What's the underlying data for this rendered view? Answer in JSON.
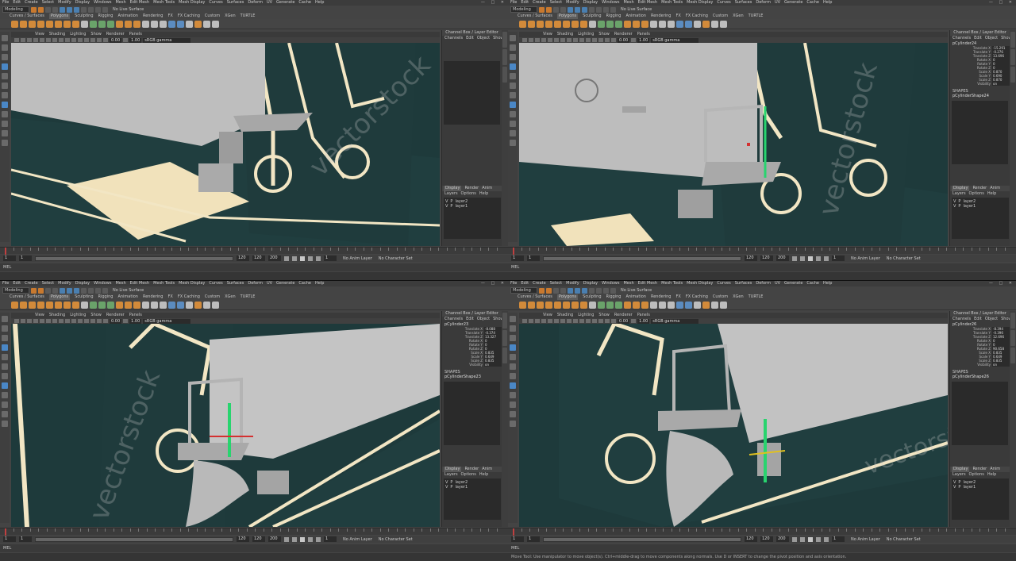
{
  "menu": [
    "File",
    "Edit",
    "Create",
    "Select",
    "Modify",
    "Display",
    "Windows",
    "Mesh",
    "Edit Mesh",
    "Mesh Tools",
    "Mesh Display",
    "Curves",
    "Surfaces",
    "Deform",
    "UV",
    "Generate",
    "Cache",
    "Help"
  ],
  "window_controls": "— □ ✕",
  "mode": "Modeling",
  "live_surface": "No Live Surface",
  "shelf_tabs": [
    "Curves / Surfaces",
    "Polygons",
    "Sculpting",
    "Rigging",
    "Animation",
    "Rendering",
    "FX",
    "FX Caching",
    "Custom",
    "XGen",
    "TURTLE"
  ],
  "active_shelf": "Polygons",
  "viewport_menu": [
    "View",
    "Shading",
    "Lighting",
    "Show",
    "Renderer",
    "Panels"
  ],
  "viewport_values": {
    "value_a": "0.00",
    "value_b": "1.00",
    "gamma": "sRGB gamma"
  },
  "panel_title": "Channel Box / Layer Editor",
  "channel_menu": [
    "Channels",
    "Edit",
    "Object",
    "Show"
  ],
  "attribute_labels": [
    "Translate X",
    "Translate Y",
    "Translate Z",
    "Rotate X",
    "Rotate Y",
    "Rotate Z",
    "Scale X",
    "Scale Y",
    "Scale Z",
    "Visibility"
  ],
  "shapes_label": "SHAPES",
  "layer_tabs": [
    "Display",
    "Render",
    "Anim"
  ],
  "layer_menu": [
    "Layers",
    "Options",
    "Help"
  ],
  "layers": [
    {
      "v": "V",
      "p": "P",
      "name": "layer2"
    },
    {
      "v": "V",
      "p": "P",
      "name": "layer1"
    }
  ],
  "time": {
    "start": "1",
    "current": "1",
    "range_start": "1",
    "range_end": "120",
    "end": "120",
    "max": "200"
  },
  "anim_layer": "No Anim Layer",
  "character_set": "No Character Set",
  "mel_label": "MEL",
  "help_text": "Move Tool: Use manipulator to move object(s). Ctrl+middle-drag to move components along normals. Use D or INSERT to change the pivot position and axis orientation.",
  "watermark": "vectorstock",
  "quadrants": [
    {
      "object": "",
      "shape": "",
      "values": [],
      "help": ""
    },
    {
      "object": "pCylinder24",
      "shape": "pCylinderShape24",
      "values": [
        "-15.291",
        "-0.276",
        "13.696",
        "0",
        "0",
        "0",
        "0.870",
        "0.690",
        "0.870",
        "on"
      ],
      "help": ""
    },
    {
      "object": "pCylinder23",
      "shape": "pCylinderShape23",
      "values": [
        "-8.088",
        "-0.374",
        "13.327",
        "0",
        "0",
        "0",
        "0.835",
        "0.649",
        "0.835",
        "on"
      ],
      "help": ""
    },
    {
      "object": "pCylinder26",
      "shape": "pCylinderShape26",
      "values": [
        "-8.394",
        "-0.396",
        "12.696",
        "0",
        "0",
        "90.658",
        "0.835",
        "0.649",
        "0.835",
        "on"
      ],
      "help": "shown"
    }
  ]
}
